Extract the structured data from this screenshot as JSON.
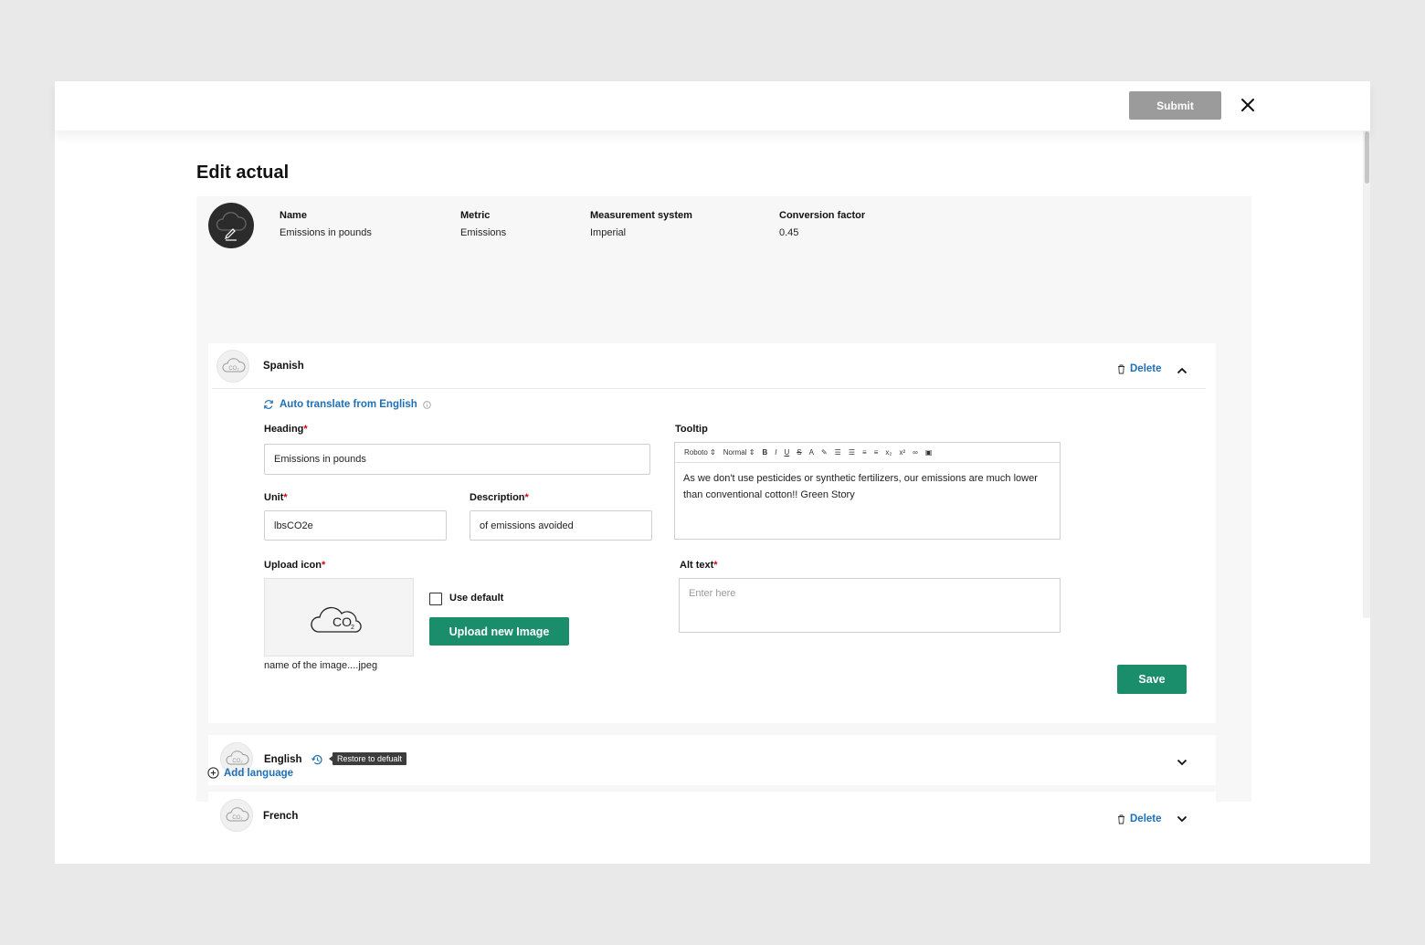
{
  "header": {
    "submit_label": "Submit",
    "close_icon": "close-icon"
  },
  "page": {
    "title": "Edit actual"
  },
  "summary": {
    "name_label": "Name",
    "name_value": "Emissions in pounds",
    "metric_label": "Metric",
    "metric_value": "Emissions",
    "system_label": "Measurement system",
    "system_value": "Imperial",
    "factor_label": "Conversion factor",
    "factor_value": "0.45"
  },
  "languages": {
    "spanish": {
      "name": "Spanish",
      "delete_label": "Delete",
      "auto_translate_label": "Auto translate from English",
      "heading_label": "Heading",
      "heading_value": "Emissions in pounds",
      "unit_label": "Unit",
      "unit_value": "lbsCO2e",
      "description_label": "Description",
      "description_value": "of emissions avoided",
      "tooltip_label": "Tooltip",
      "tooltip_toolbar": {
        "font": "Roboto",
        "size": "Normal"
      },
      "tooltip_text": "As we don't use pesticides or synthetic fertilizers, our emissions are much lower than conventional cotton!! Green Story",
      "upload_label": "Upload icon",
      "use_default_label": "Use default",
      "use_default_checked": false,
      "upload_button_label": "Upload new Image",
      "file_name": "name of the image....jpeg",
      "alt_text_label": "Alt text",
      "alt_text_placeholder": "Enter here",
      "save_label": "Save"
    },
    "english": {
      "name": "English",
      "restore_tooltip": "Restore to defualt"
    },
    "french": {
      "name": "French",
      "delete_label": "Delete"
    }
  },
  "add_language_label": "Add language",
  "colors": {
    "accent_green": "#1a8d6a",
    "link_blue": "#1f6fb5",
    "required_red": "#d0021b",
    "submit_disabled": "#9b9b9b"
  }
}
